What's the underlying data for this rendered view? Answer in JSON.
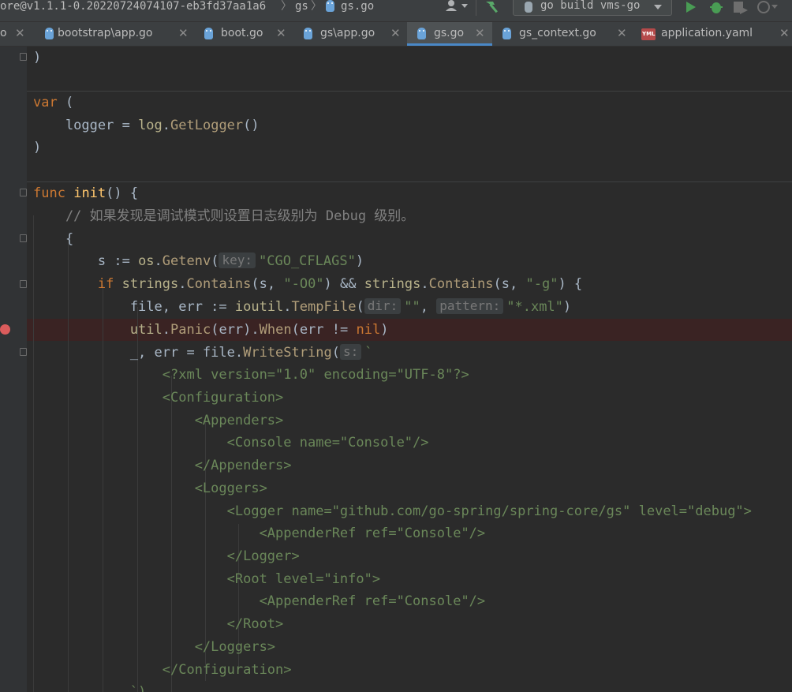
{
  "navbar": {
    "module_crumb": "ore@v1.1.1-0.20220724074107-eb3fd37aa1a6",
    "dir_crumb": "gs",
    "file_crumb": "gs.go",
    "run_config": "go build vms-go",
    "icons": [
      "user-icon",
      "build-hammer-icon",
      "run-icon",
      "debug-icon",
      "coverage-icon",
      "profile-icon"
    ]
  },
  "tabs": [
    {
      "label": "o",
      "icon": "none",
      "active": false
    },
    {
      "label": "bootstrap\\app.go",
      "icon": "go-gopher-icon",
      "active": false
    },
    {
      "label": "boot.go",
      "icon": "go-gopher-icon",
      "active": false
    },
    {
      "label": "gs\\app.go",
      "icon": "go-gopher-icon",
      "active": false
    },
    {
      "label": "gs.go",
      "icon": "go-gopher-icon",
      "active": true
    },
    {
      "label": "gs_context.go",
      "icon": "go-gopher-icon",
      "active": false
    },
    {
      "label": "application.yaml",
      "icon": "yaml-icon",
      "active": false
    }
  ],
  "code": {
    "l1": ")",
    "l2_kw": "var",
    "l2_rest": " (",
    "l3_a": "    logger = ",
    "l3_pkg": "log",
    "l3_dot": ".",
    "l3_fn": "GetLogger",
    "l3_end": "()",
    "l4": ")",
    "l5_kw": "func",
    "l5_fn": "init",
    "l5_end": "() {",
    "l6": "    // 如果发现是调试模式则设置日志级别为 Debug 级别。",
    "l7": "    {",
    "l8_a": "        s := ",
    "l8_pkg": "os",
    "l8_dot": ".",
    "l8_fn": "Getenv",
    "l8_paren": "(",
    "l8_hint": "key:",
    "l8_str": "\"CGO_CFLAGS\"",
    "l8_end": ")",
    "l9_kw": "        if",
    "l9_sp": " ",
    "l9_pkg1": "strings",
    "l9_dot1": ".",
    "l9_fn1": "Contains",
    "l9_b": "(s, ",
    "l9_str1": "\"-O0\"",
    "l9_c": ") && ",
    "l9_pkg2": "strings",
    "l9_dot2": ".",
    "l9_fn2": "Contains",
    "l9_d": "(s, ",
    "l9_str2": "\"-g\"",
    "l9_end": ") {",
    "l10_a": "            file, err := ",
    "l10_pkg": "ioutil",
    "l10_dot": ".",
    "l10_fn": "TempFile",
    "l10_paren": "(",
    "l10_hint1": "dir:",
    "l10_str1": "\"\"",
    "l10_comma": ", ",
    "l10_hint2": "pattern:",
    "l10_str2": "\"*.xml\"",
    "l10_end": ")",
    "l11_a": "            ",
    "l11_pkg": "util",
    "l11_dot1": ".",
    "l11_fn1": "Panic",
    "l11_b": "(err).",
    "l11_fn2": "When",
    "l11_c": "(err != ",
    "l11_kw": "nil",
    "l11_end": ")",
    "l12_a": "            _, err = file.",
    "l12_fn": "WriteString",
    "l12_paren": "(",
    "l12_hint": "s:",
    "l12_str": "`",
    "l13": "                <?xml version=\"1.0\" encoding=\"UTF-8\"?>",
    "l14": "                <Configuration>",
    "l15": "                    <Appenders>",
    "l16": "                        <Console name=\"Console\"/>",
    "l17": "                    </Appenders>",
    "l18": "                    <Loggers>",
    "l19": "                        <Logger name=\"github.com/go-spring/spring-core/gs\" level=\"debug\">",
    "l20": "                            <AppenderRef ref=\"Console\"/>",
    "l21": "                        </Logger>",
    "l22": "                        <Root level=\"info\">",
    "l23": "                            <AppenderRef ref=\"Console\"/>",
    "l24": "                        </Root>",
    "l25": "                    </Loggers>",
    "l26": "                </Configuration>",
    "l27": "            `)"
  }
}
